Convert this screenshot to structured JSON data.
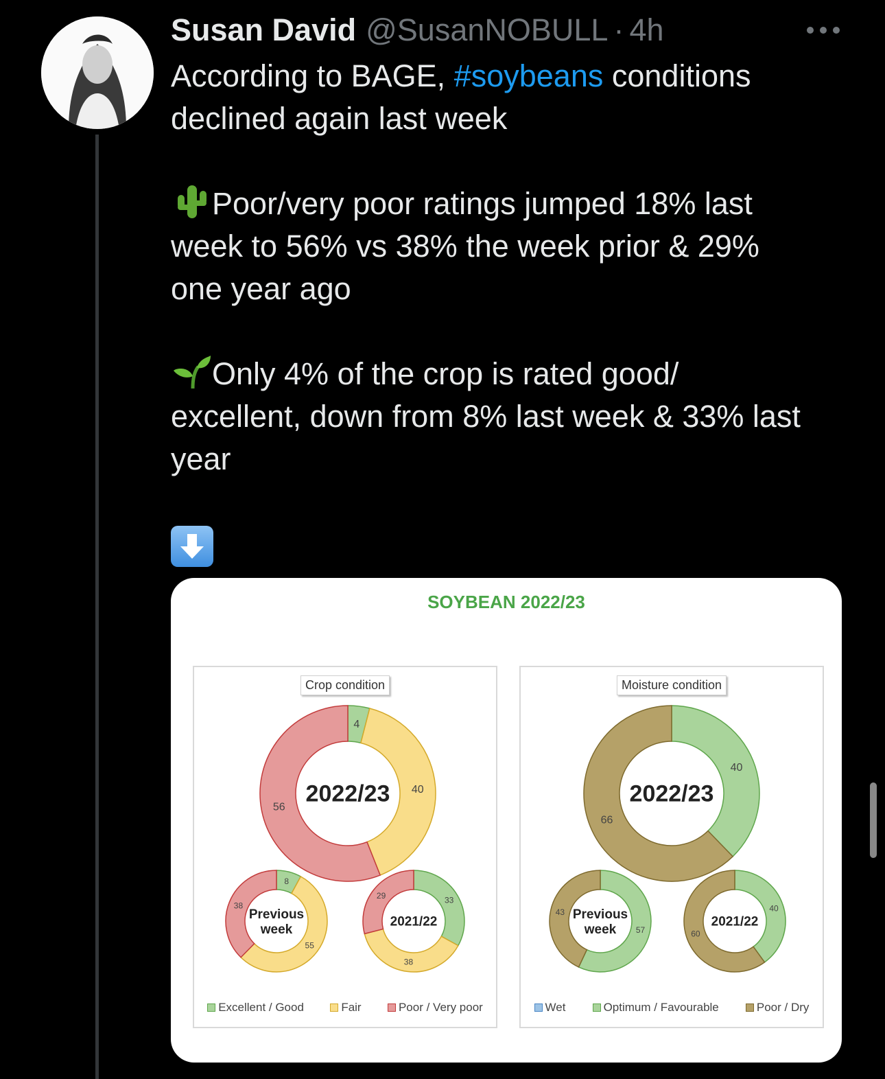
{
  "tweet": {
    "author_name": "Susan David",
    "handle": "@SusanNOBULL",
    "separator": "·",
    "time": "4h",
    "line1_pre": "According to BAGE, ",
    "hashtag": "#soybeans",
    "line1_post": " conditions declined again last week",
    "para2": "Poor/very poor ratings jumped 18% last week to 56% vs 38% the week prior & 29% one year ago",
    "para3": "Only 4% of the crop is rated good/ excellent, down from 8% last week & 33% last year",
    "emoji_names": [
      "cactus-icon",
      "seedling-icon",
      "down-arrow-icon"
    ]
  },
  "card": {
    "title": "SOYBEAN 2022/23"
  },
  "colors": {
    "good": "#a9d49b",
    "fair": "#f9dd8a",
    "poor": "#e59a9a",
    "wet": "#9cc3e6",
    "optimum": "#a9d49b",
    "dry": "#b5a168",
    "title_green": "#4aa548",
    "hashtag": "#1d9bf0"
  },
  "chart_data": [
    {
      "type": "pie",
      "title": "Crop condition",
      "legend": [
        "Excellent / Good",
        "Fair",
        "Poor / Very poor"
      ],
      "rings": [
        {
          "label": "2022/23",
          "values": [
            4,
            40,
            56
          ]
        },
        {
          "label": "Previous week",
          "values": [
            8,
            55,
            38
          ]
        },
        {
          "label": "2021/22",
          "values": [
            33,
            38,
            29
          ]
        }
      ]
    },
    {
      "type": "pie",
      "title": "Moisture condition",
      "legend": [
        "Wet",
        "Optimum / Favourable",
        "Poor / Dry"
      ],
      "rings": [
        {
          "label": "2022/23",
          "values": [
            0,
            40,
            66
          ]
        },
        {
          "label": "Previous week",
          "values": [
            0,
            57,
            43
          ]
        },
        {
          "label": "2021/22",
          "values": [
            0,
            40,
            60
          ]
        }
      ]
    }
  ]
}
